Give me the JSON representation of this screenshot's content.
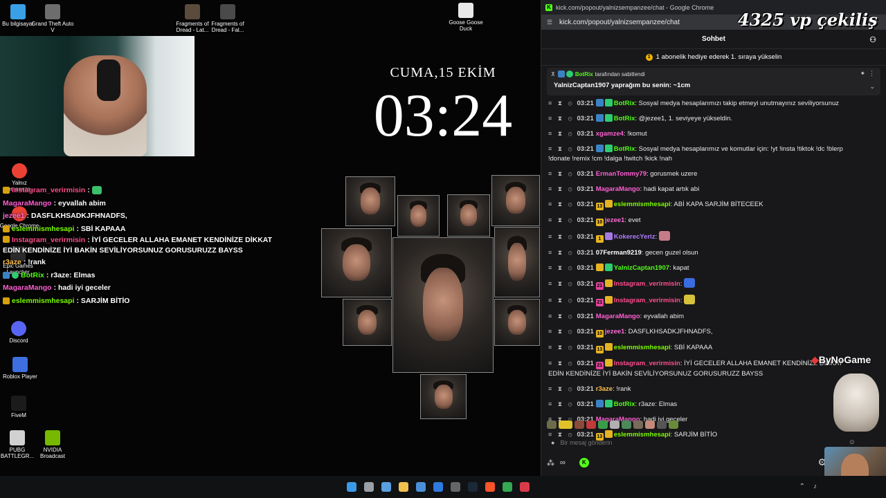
{
  "desktop": {
    "icons": [
      {
        "label": "Bu bilgisayar",
        "icon": "computer-icon",
        "color": "#3aa0e6"
      },
      {
        "label": "Grand Theft Auto V",
        "icon": "gta-icon",
        "color": "#6d6d6d"
      },
      {
        "label": "Fragments of Dread - Lat...",
        "icon": "game-icon",
        "color": "#5a4b3c"
      },
      {
        "label": "Fragments of Dread - Fal...",
        "icon": "game-icon",
        "color": "#4a4a4a"
      },
      {
        "label": "Goose Goose Duck",
        "icon": "goose-icon",
        "color": "#e8e8e8"
      },
      {
        "label": "Yalnız Sempanze...",
        "icon": "chrome-icon",
        "color": "#e94235"
      },
      {
        "label": "Google Chrome",
        "icon": "chrome-icon",
        "color": "#e94235"
      },
      {
        "label": "Epic Games Launcher",
        "icon": "epic-icon",
        "color": "#2b2b2b"
      },
      {
        "label": "Discord",
        "icon": "discord-icon",
        "color": "#5865f2"
      },
      {
        "label": "Roblox Player",
        "icon": "roblox-icon",
        "color": "#3d6fe0"
      },
      {
        "label": "FiveM",
        "icon": "fivem-icon",
        "color": "#1b1b1b"
      },
      {
        "label": "PUBG BATTLEGR...",
        "icon": "pubg-icon",
        "color": "#d1d1d1"
      },
      {
        "label": "NVIDIA Broadcast",
        "icon": "nvidia-icon",
        "color": "#76b900"
      }
    ]
  },
  "stream_overlay": {
    "clock_date": "CUMA,15 EKİM",
    "clock_time": "03:24",
    "chat": [
      {
        "user": "Instagram_verirmisin",
        "text": "",
        "color": "#ff4d8d",
        "emote": "#3bbf6a"
      },
      {
        "user": "MagaraMango",
        "text": "eyvallah abim",
        "color": "#ff5fd2"
      },
      {
        "user": "jezee1",
        "text": "DASFLKHSADKJFHNADFS,",
        "color": "#ff6bd6"
      },
      {
        "user": "eslemmismhesapi",
        "text": "SBİ KAPAAA",
        "color": "#7cfc00"
      },
      {
        "user": "Instagram_verirmisin",
        "text": "İYİ GECELER ALLAHA EMANET KENDİNİZE DİKKAT EDİN KENDİNİZE İYİ BAKİN SEVİLİYORSUNUZ GORUSURUZZ BAYSS",
        "color": "#ff4d8d"
      },
      {
        "user": "r3aze",
        "text": "!rank",
        "color": "#ffc04d"
      },
      {
        "user": "BotRix",
        "text": "r3aze: Elmas",
        "color": "#53fc18"
      },
      {
        "user": "MagaraMango",
        "text": "hadi iyi geceler",
        "color": "#ff5fd2"
      },
      {
        "user": "eslemmismhesapi",
        "text": "SARJİM BİTİO",
        "color": "#7cfc00"
      }
    ]
  },
  "browser": {
    "title": "kick.com/popout/yalnizsempanzee/chat - Google Chrome",
    "url": "kick.com/popout/yalnizsempanzee/chat",
    "chat_header": "Sohbet",
    "gift_text": "1 abonelik hediye ederek 1. sıraya yükselin",
    "pinned": {
      "by_user": "BotRix",
      "by_text": "tarafından sabitlendi",
      "message": "YalnizCaptan1907 yaprağım bu senin: ~1cm"
    },
    "messages": [
      {
        "time": "03:21",
        "badges": [
          "#3b82c4",
          "#2ecc71"
        ],
        "user": "BotRix",
        "color": "#53fc18",
        "text": "Sosyal medya hesaplarımızı takip etmeyi unutmayınız seviliyorsunuz"
      },
      {
        "time": "03:21",
        "badges": [
          "#3b82c4",
          "#2ecc71"
        ],
        "user": "BotRix",
        "color": "#53fc18",
        "text": "@jezee1, 1. seviyeye yükseldin."
      },
      {
        "time": "03:21",
        "badges": [],
        "user": "xgamze4",
        "color": "#ff5fd2",
        "text": "!komut"
      },
      {
        "time": "03:21",
        "badges": [
          "#3b82c4",
          "#2ecc71"
        ],
        "user": "BotRix",
        "color": "#53fc18",
        "text": "Sosyal medya hesaplarımız ve komutlar için: !yt !insta !tiktok !dc !blerp !donate !remix !cm !dalga !twitch !kick !nah"
      },
      {
        "time": "03:21",
        "badges": [],
        "user": "ErmanTommy79",
        "color": "#ff5fd2",
        "text": "gorusmek uzere"
      },
      {
        "time": "03:21",
        "badges": [],
        "user": "MagaraMango",
        "color": "#ff5fd2",
        "text": "hadi kapat artık abi"
      },
      {
        "time": "03:21",
        "badges": [
          "#e6b422",
          "#e6b422"
        ],
        "badge_text": "13",
        "user": "eslemmismhesapi",
        "color": "#7cfc00",
        "text": "ABİ KAPA SARJİM BİTECEEK"
      },
      {
        "time": "03:21",
        "badges": [
          "#e6b422"
        ],
        "badge_text": "10",
        "user": "jezee1",
        "color": "#ff6bd6",
        "text": "evet"
      },
      {
        "time": "03:21",
        "badges": [
          "#e6b422",
          "#a57be0"
        ],
        "badge_text": "1",
        "user": "KokerecYeriz",
        "color": "#b07cff",
        "text": "",
        "emote": "#c77b89"
      },
      {
        "time": "03:21",
        "badges": [],
        "user": "07Ferman9219",
        "color": "#ffffff",
        "text": "gecen guzel olsun"
      },
      {
        "time": "03:21",
        "badges": [
          "#e6b422",
          "#2ecc71"
        ],
        "user": "YalnizCaptan1907",
        "color": "#53fc18",
        "text": "kapat"
      },
      {
        "time": "03:21",
        "badges": [
          "#e0459a",
          "#e6b422"
        ],
        "badge_text": "21",
        "user": "Instagram_verirmisin",
        "color": "#ff4d8d",
        "text": "",
        "emote": "#3b6be0"
      },
      {
        "time": "03:21",
        "badges": [
          "#e0459a",
          "#e6b422"
        ],
        "badge_text": "21",
        "user": "Instagram_verirmisin",
        "color": "#ff4d8d",
        "text": "",
        "emote": "#d8c13b"
      },
      {
        "time": "03:21",
        "badges": [],
        "user": "MagaraMango",
        "color": "#ff5fd2",
        "text": "eyvallah abim"
      },
      {
        "time": "03:21",
        "badges": [
          "#e6b422"
        ],
        "badge_text": "10",
        "user": "jezee1",
        "color": "#ff6bd6",
        "text": "DASFLKHSADKJFHNADFS,"
      },
      {
        "time": "03:21",
        "badges": [
          "#e6b422",
          "#e6b422"
        ],
        "badge_text": "13",
        "user": "eslemmismhesapi",
        "color": "#7cfc00",
        "text": "SBİ KAPAAA"
      },
      {
        "time": "03:21",
        "badges": [
          "#e0459a",
          "#e6b422"
        ],
        "badge_text": "21",
        "user": "Instagram_verirmisin",
        "color": "#ff4d8d",
        "text": "İYİ GECELER ALLAHA EMANET KENDİNİZE DİKKAT EDİN KENDİNİZE İYİ BAKİN SEVİLİYORSUNUZ GORUSURUZZ BAYSS"
      },
      {
        "time": "03:21",
        "badges": [],
        "user": "r3aze",
        "color": "#ffc04d",
        "text": "!rank"
      },
      {
        "time": "03:21",
        "badges": [
          "#3b82c4",
          "#2ecc71"
        ],
        "user": "BotRix",
        "color": "#53fc18",
        "text": "r3aze: Elmas"
      },
      {
        "time": "03:21",
        "badges": [],
        "user": "MagaraMango",
        "color": "#ff5fd2",
        "text": "hadi iyi geceler"
      },
      {
        "time": "03:21",
        "badges": [
          "#e6b422",
          "#e6b422"
        ],
        "badge_text": "13",
        "user": "eslemmismhesapi",
        "color": "#7cfc00",
        "text": "SARJİM BİTİO"
      }
    ],
    "input_placeholder": "Bir mesaj gönderin"
  },
  "overlays": {
    "giveaway": "4325 vp çekiliş",
    "sponsor": "ByNoGame"
  },
  "taskbar": {
    "icons": [
      {
        "name": "windows-start-icon",
        "color": "#3b9ae8"
      },
      {
        "name": "task-view-icon",
        "color": "#9aa0a6"
      },
      {
        "name": "snipping-tool-icon",
        "color": "#5aa0e0"
      },
      {
        "name": "file-explorer-icon",
        "color": "#f2c14e"
      },
      {
        "name": "photos-icon",
        "color": "#4a90d9"
      },
      {
        "name": "mail-icon",
        "color": "#2d7be0"
      },
      {
        "name": "obs-icon",
        "color": "#666666"
      },
      {
        "name": "steam-icon",
        "color": "#1b2838"
      },
      {
        "name": "brave-icon",
        "color": "#fb542b"
      },
      {
        "name": "chrome-icon",
        "color": "#34a853"
      },
      {
        "name": "app-red-icon",
        "color": "#d93a4a"
      }
    ]
  }
}
